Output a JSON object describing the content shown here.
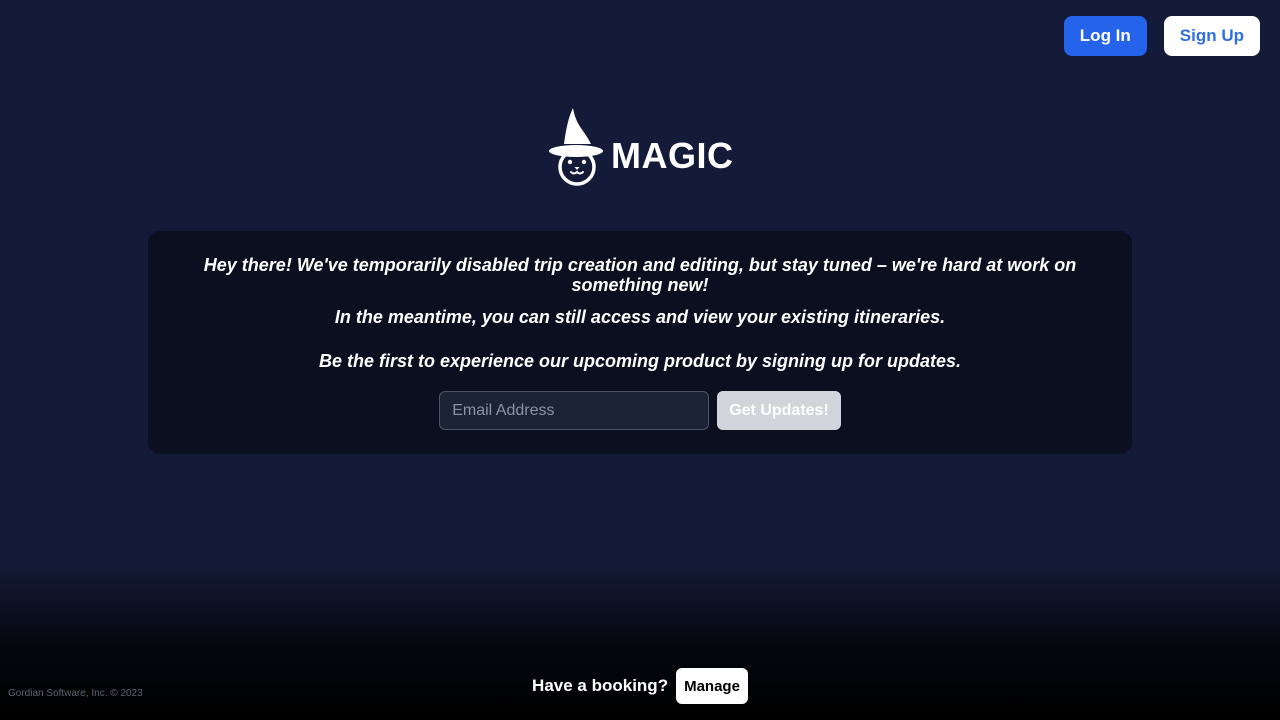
{
  "header": {
    "login_label": "Log In",
    "signup_label": "Sign Up"
  },
  "brand": {
    "name": "MAGIC",
    "icon": "wizard-hat-cat-logo"
  },
  "notice": {
    "line1": "Hey there! We've temporarily disabled trip creation and editing, but stay tuned – we're hard at work on something new!",
    "line2": "In the meantime, you can still access and view your existing itineraries.",
    "line3": "Be the first to experience our upcoming product by signing up for updates."
  },
  "signup": {
    "email_placeholder": "Email Address",
    "email_value": "",
    "submit_label": "Get Updates!"
  },
  "booking": {
    "label": "Have a booking?",
    "manage_label": "Manage"
  },
  "footer": {
    "copyright": "Gordian Software, Inc. © 2023"
  },
  "colors": {
    "background": "#141b38",
    "card": "#0b0f20",
    "primary": "#2563eb",
    "signup_text": "#2f6fdf",
    "disabled_button": "#d1d5db"
  }
}
